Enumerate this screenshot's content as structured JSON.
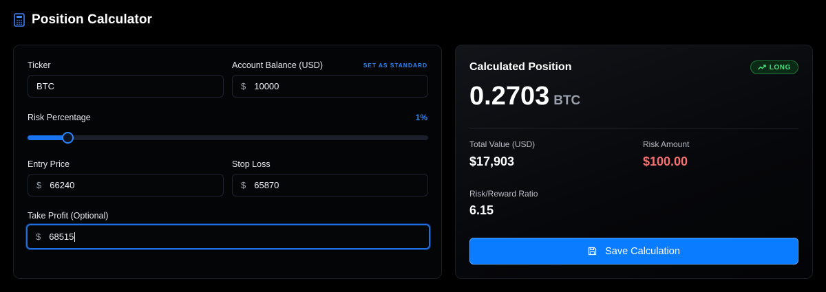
{
  "header": {
    "title": "Position Calculator",
    "icon": "calculator-icon"
  },
  "form": {
    "ticker": {
      "label": "Ticker",
      "value": "BTC"
    },
    "balance": {
      "label": "Account Balance (USD)",
      "currency": "$",
      "value": "10000",
      "set_standard": "SET AS STANDARD"
    },
    "risk": {
      "label": "Risk Percentage",
      "value_text": "1%",
      "fraction": 0.1
    },
    "entry": {
      "label": "Entry Price",
      "currency": "$",
      "value": "66240"
    },
    "stop": {
      "label": "Stop Loss",
      "currency": "$",
      "value": "65870"
    },
    "take_profit": {
      "label": "Take Profit (Optional)",
      "currency": "$",
      "value": "68515"
    }
  },
  "result": {
    "title": "Calculated Position",
    "badge": "LONG",
    "badge_icon": "trending-up-icon",
    "badge_color": "#4ade80",
    "position_size": "0.2703",
    "unit": "BTC",
    "total_value_label": "Total Value (USD)",
    "total_value": "$17,903",
    "risk_amount_label": "Risk Amount",
    "risk_amount": "$100.00",
    "risk_amount_color": "#f87171",
    "rr_label": "Risk/Reward Ratio",
    "rr_value": "6.15",
    "save_label": "Save Calculation",
    "save_icon": "save-icon",
    "accent": "#0a7cff"
  }
}
